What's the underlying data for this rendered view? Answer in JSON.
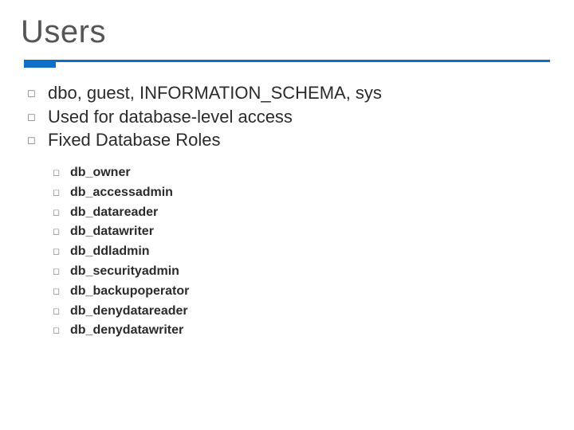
{
  "title": "Users",
  "bullets": [
    "dbo, guest, INFORMATION_SCHEMA, sys",
    "Used for database-level access",
    "Fixed Database Roles"
  ],
  "roles": [
    "db_owner",
    "db_accessadmin",
    "db_datareader",
    "db_datawriter",
    "db_ddladmin",
    "db_securityadmin",
    "db_backupoperator",
    "db_denydatareader",
    "db_denydatawriter"
  ]
}
